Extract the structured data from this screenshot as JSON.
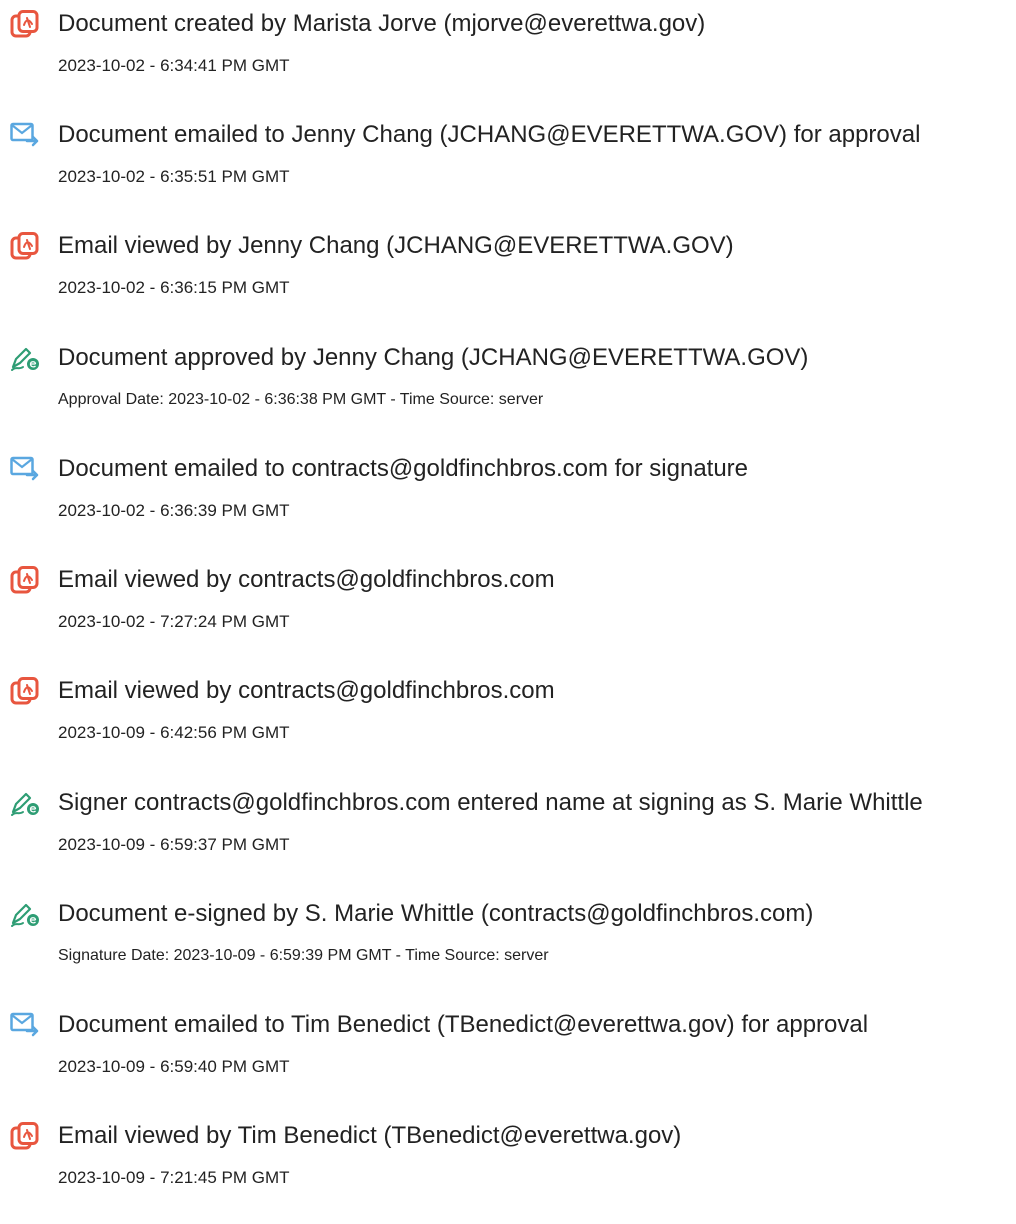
{
  "events": [
    {
      "icon": "acrobat-document-icon",
      "title": "Document created by Marista Jorve (mjorve@everettwa.gov)",
      "detail": "2023-10-02 - 6:34:41 PM GMT"
    },
    {
      "icon": "email-sent-icon",
      "title": "Document emailed to Jenny Chang (JCHANG@EVERETTWA.GOV) for approval",
      "detail": "2023-10-02 - 6:35:51 PM GMT"
    },
    {
      "icon": "acrobat-document-icon",
      "title": "Email viewed by Jenny Chang (JCHANG@EVERETTWA.GOV)",
      "detail": "2023-10-02 - 6:36:15 PM GMT"
    },
    {
      "icon": "esign-pen-icon",
      "title": "Document approved by Jenny Chang (JCHANG@EVERETTWA.GOV)",
      "detail": "Approval Date: 2023-10-02 - 6:36:38 PM GMT - Time Source: server"
    },
    {
      "icon": "email-sent-icon",
      "title": "Document emailed to contracts@goldfinchbros.com for signature",
      "detail": "2023-10-02 - 6:36:39 PM GMT"
    },
    {
      "icon": "acrobat-document-icon",
      "title": "Email viewed by contracts@goldfinchbros.com",
      "detail": "2023-10-02 - 7:27:24 PM GMT"
    },
    {
      "icon": "acrobat-document-icon",
      "title": "Email viewed by contracts@goldfinchbros.com",
      "detail": "2023-10-09 - 6:42:56 PM GMT"
    },
    {
      "icon": "esign-pen-icon",
      "title": "Signer contracts@goldfinchbros.com entered name at signing as S. Marie Whittle",
      "detail": "2023-10-09 - 6:59:37 PM GMT"
    },
    {
      "icon": "esign-pen-icon",
      "title": "Document e-signed by S. Marie Whittle (contracts@goldfinchbros.com)",
      "detail": "Signature Date: 2023-10-09 - 6:59:39 PM GMT - Time Source: server"
    },
    {
      "icon": "email-sent-icon",
      "title": "Document emailed to Tim Benedict (TBenedict@everettwa.gov) for approval",
      "detail": "2023-10-09 - 6:59:40 PM GMT"
    },
    {
      "icon": "acrobat-document-icon",
      "title": "Email viewed by Tim Benedict (TBenedict@everettwa.gov)",
      "detail": "2023-10-09 - 7:21:45 PM GMT"
    }
  ],
  "colors": {
    "acrobat_red": "#E8563F",
    "email_blue": "#5AA7E0",
    "esign_green": "#2E9D74",
    "text": "#222222"
  }
}
